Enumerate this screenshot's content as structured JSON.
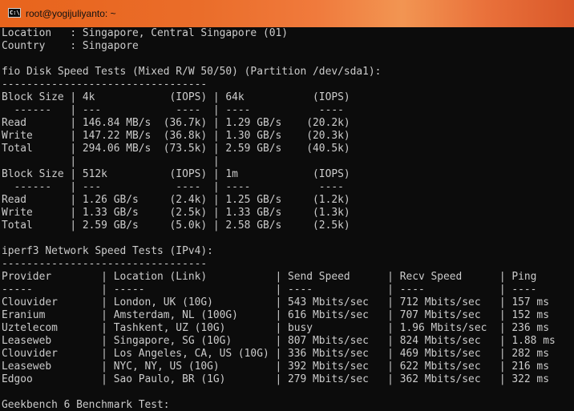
{
  "window": {
    "title": "root@yogijuliyanto: ~",
    "icon": "console-icon",
    "titlebar_colors": [
      "#e8641c",
      "#f29552",
      "#d9582a"
    ]
  },
  "terminal": {
    "background": "#0c0c0c",
    "foreground": "#cccccc",
    "lines": [
      "Location   : Singapore, Central Singapore (01)",
      "Country    : Singapore",
      "",
      "fio Disk Speed Tests (Mixed R/W 50/50) (Partition /dev/sda1):",
      "---------------------------------",
      "Block Size | 4k            (IOPS) | 64k           (IOPS)",
      "  ------   | ---            ----  | ----           ----",
      "Read       | 146.84 MB/s  (36.7k) | 1.29 GB/s    (20.2k)",
      "Write      | 147.22 MB/s  (36.8k) | 1.30 GB/s    (20.3k)",
      "Total      | 294.06 MB/s  (73.5k) | 2.59 GB/s    (40.5k)",
      "           |                      |",
      "Block Size | 512k          (IOPS) | 1m            (IOPS)",
      "  ------   | ---            ----  | ----           ----",
      "Read       | 1.26 GB/s     (2.4k) | 1.25 GB/s     (1.2k)",
      "Write      | 1.33 GB/s     (2.5k) | 1.33 GB/s     (1.3k)",
      "Total      | 2.59 GB/s     (5.0k) | 2.58 GB/s     (2.5k)",
      "",
      "iperf3 Network Speed Tests (IPv4):",
      "---------------------------------",
      "Provider        | Location (Link)           | Send Speed      | Recv Speed      | Ping",
      "-----           | -----                     | ----            | ----            | ----",
      "Clouvider       | London, UK (10G)          | 543 Mbits/sec   | 712 Mbits/sec   | 157 ms",
      "Eranium         | Amsterdam, NL (100G)      | 616 Mbits/sec   | 707 Mbits/sec   | 152 ms",
      "Uztelecom       | Tashkent, UZ (10G)        | busy            | 1.96 Mbits/sec  | 236 ms",
      "Leaseweb        | Singapore, SG (10G)       | 807 Mbits/sec   | 824 Mbits/sec   | 1.88 ms",
      "Clouvider       | Los Angeles, CA, US (10G) | 336 Mbits/sec   | 469 Mbits/sec   | 282 ms",
      "Leaseweb        | NYC, NY, US (10G)         | 392 Mbits/sec   | 622 Mbits/sec   | 216 ms",
      "Edgoo           | Sao Paulo, BR (1G)        | 279 Mbits/sec   | 362 Mbits/sec   | 322 ms",
      "",
      "Geekbench 6 Benchmark Test:"
    ]
  }
}
